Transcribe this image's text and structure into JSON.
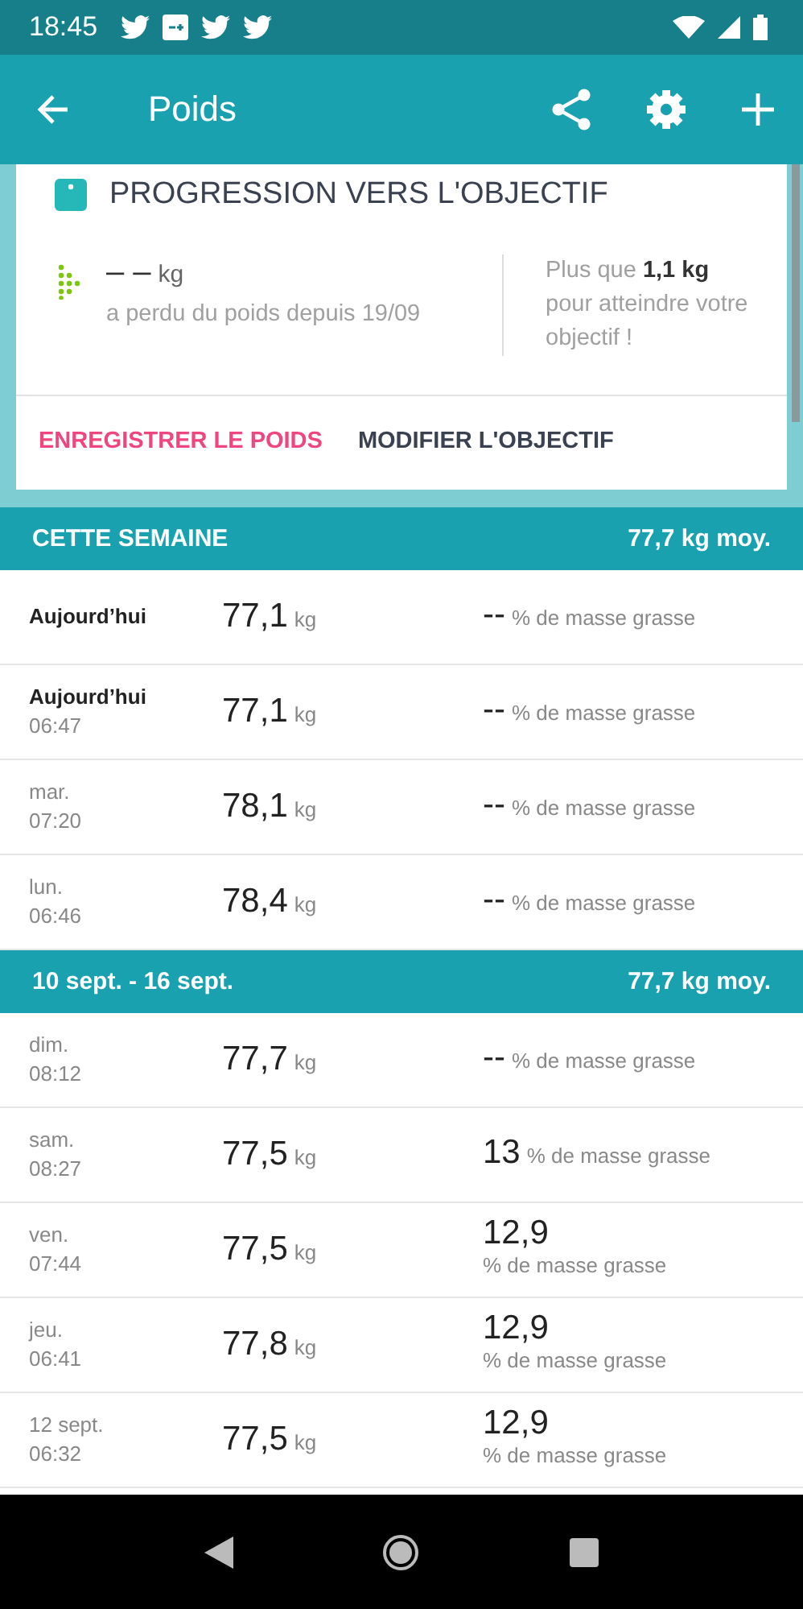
{
  "status_bar": {
    "time": "18:45"
  },
  "toolbar": {
    "title": "Poids"
  },
  "goal_card": {
    "title": "PROGRESSION VERS L'OBJECTIF",
    "value": "– –",
    "unit": "kg",
    "caption": "a perdu du poids depuis 19/09",
    "remaining": "Plus que **1,1 kg** pour atteindre votre objectif !",
    "actions": [
      {
        "label": "ENREGISTRER LE POIDS",
        "kind": "primary"
      },
      {
        "label": "MODIFIER L'OBJECTIF",
        "kind": "secondary"
      }
    ]
  },
  "sections": [
    {
      "title": "CETTE SEMAINE",
      "average": "77,7 kg moy.",
      "entries": [
        {
          "day": "Aujourd’hui",
          "emphasized": true,
          "weight": "77,1",
          "unit": "kg",
          "fat": "--",
          "fat_label": "% de masse grasse"
        },
        {
          "day": "Aujourd’hui",
          "time": "06:47",
          "emphasized": true,
          "weight": "77,1",
          "unit": "kg",
          "fat": "--",
          "fat_label": "% de masse grasse"
        },
        {
          "day": "mar.",
          "time": "07:20",
          "emphasized": false,
          "weight": "78,1",
          "unit": "kg",
          "fat": "--",
          "fat_label": "% de masse grasse"
        },
        {
          "day": "lun.",
          "time": "06:46",
          "emphasized": false,
          "weight": "78,4",
          "unit": "kg",
          "fat": "--",
          "fat_label": "% de masse grasse"
        }
      ]
    },
    {
      "title": "10 sept. - 16 sept.",
      "average": "77,7 kg moy.",
      "entries": [
        {
          "day": "dim.",
          "time": "08:12",
          "emphasized": false,
          "weight": "77,7",
          "unit": "kg",
          "fat": "--",
          "fat_label": "% de masse grasse"
        },
        {
          "day": "sam.",
          "time": "08:27",
          "emphasized": false,
          "weight": "77,5",
          "unit": "kg",
          "fat": "13",
          "fat_label": "% de masse grasse"
        },
        {
          "day": "ven.",
          "time": "07:44",
          "emphasized": false,
          "weight": "77,5",
          "unit": "kg",
          "fat": "12,9",
          "fat_label": "% de masse grasse"
        },
        {
          "day": "jeu.",
          "time": "06:41",
          "emphasized": false,
          "weight": "77,8",
          "unit": "kg",
          "fat": "12,9",
          "fat_label": "% de masse grasse"
        },
        {
          "day": "12 sept.",
          "time": "06:32",
          "emphasized": false,
          "weight": "77,5",
          "unit": "kg",
          "fat": "12,9",
          "fat_label": "% de masse grasse"
        }
      ]
    }
  ]
}
